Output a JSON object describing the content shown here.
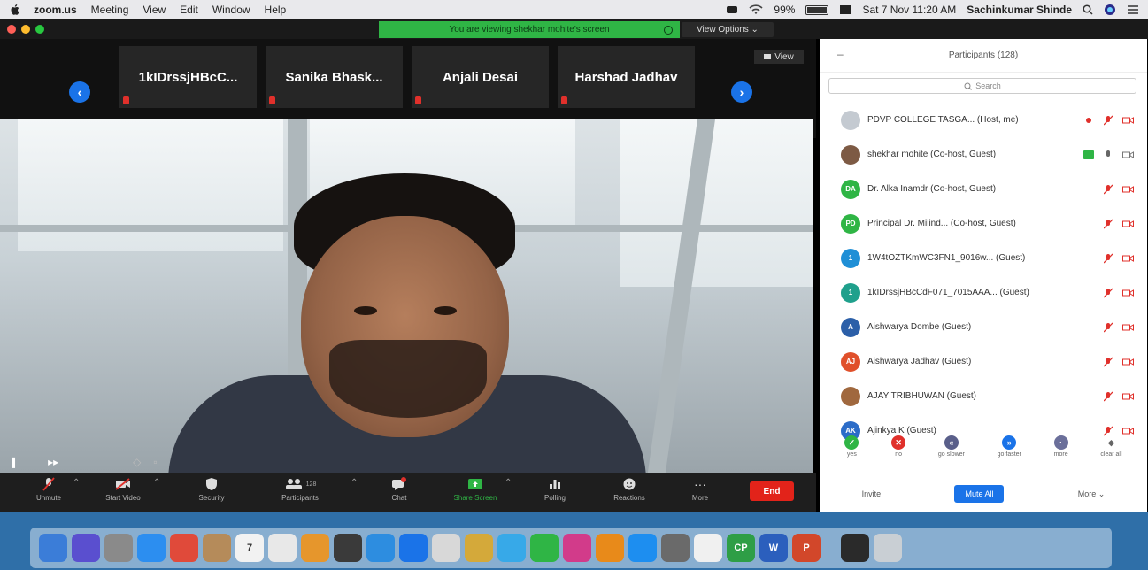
{
  "menubar": {
    "app": "zoom.us",
    "items": [
      "Meeting",
      "View",
      "Edit",
      "Window",
      "Help"
    ],
    "battery": "99%",
    "datetime": "Sat 7 Nov 11:20 AM",
    "user": "Sachinkumar Shinde"
  },
  "banner": {
    "text": "You are viewing shekhar mohite's screen",
    "view_options": "View Options ⌄"
  },
  "strip": {
    "thumbnails": [
      "1kIDrssjHBcC...",
      "Sanika Bhask...",
      "Anjali Desai",
      "Harshad Jadhav"
    ],
    "view_label": "View"
  },
  "toolbar": {
    "unmute": "Unmute",
    "start_video": "Start Video",
    "security": "Security",
    "participants": "Participants",
    "participants_count": "128",
    "chat": "Chat",
    "share_screen": "Share Screen",
    "polling": "Polling",
    "reactions": "Reactions",
    "more": "More",
    "end": "End"
  },
  "panel": {
    "title": "Participants (128)",
    "search_placeholder": "Search",
    "participants": [
      {
        "initials": "",
        "name": "PDVP COLLEGE TASGA... (Host, me)",
        "color": "#9aa3ad"
      },
      {
        "initials": "",
        "name": "shekhar mohite (Co-host, Guest)",
        "color": "#7d5a44"
      },
      {
        "initials": "DA",
        "name": "Dr. Alka Inamdr (Co-host, Guest)",
        "color": "#2fb545"
      },
      {
        "initials": "PD",
        "name": "Principal Dr. Milind... (Co-host, Guest)",
        "color": "#2fb545"
      },
      {
        "initials": "1",
        "name": "1W4tOZTKmWC3FN1_9016w... (Guest)",
        "color": "#1f8fd6"
      },
      {
        "initials": "1",
        "name": "1kIDrssjHBcCdF071_7015AAA... (Guest)",
        "color": "#1fa08c"
      },
      {
        "initials": "A",
        "name": "Aishwarya Dombe (Guest)",
        "color": "#2b5fa8"
      },
      {
        "initials": "AJ",
        "name": "Aishwarya Jadhav (Guest)",
        "color": "#e0502b"
      },
      {
        "initials": "",
        "name": "AJAY TRIBHUWAN (Guest)",
        "color": "#a0683e"
      },
      {
        "initials": "AK",
        "name": "Ajinkya K (Guest)",
        "color": "#2b6cc8"
      }
    ],
    "reactions": [
      "yes",
      "no",
      "go slower",
      "go faster",
      "more",
      "clear all"
    ],
    "invite": "Invite",
    "mute_all": "Mute All",
    "more": "More ⌄"
  },
  "dock": {
    "apps": [
      {
        "label": "",
        "color": "#3b7dd8"
      },
      {
        "label": "",
        "color": "#5a4fcf"
      },
      {
        "label": "",
        "color": "#8a8a8a"
      },
      {
        "label": "",
        "color": "#2c8ef0"
      },
      {
        "label": "",
        "color": "#e04a3a"
      },
      {
        "label": "",
        "color": "#b58b5a"
      },
      {
        "label": "7",
        "color": "#f2f2f2"
      },
      {
        "label": "",
        "color": "#e8e8e8"
      },
      {
        "label": "",
        "color": "#e6962c"
      },
      {
        "label": "",
        "color": "#3a3a3a"
      },
      {
        "label": "",
        "color": "#2d8de0"
      },
      {
        "label": "",
        "color": "#1a73e8"
      },
      {
        "label": "",
        "color": "#d8d8d8"
      },
      {
        "label": "",
        "color": "#d4a93a"
      },
      {
        "label": "",
        "color": "#37a9e8"
      },
      {
        "label": "",
        "color": "#2fb545"
      },
      {
        "label": "",
        "color": "#d23b8a"
      },
      {
        "label": "",
        "color": "#e88a1a"
      },
      {
        "label": "",
        "color": "#1d8ef0"
      },
      {
        "label": "",
        "color": "#6a6a6a"
      },
      {
        "label": "",
        "color": "#f0f0f0"
      },
      {
        "label": "CP",
        "color": "#2e9e46"
      },
      {
        "label": "W",
        "color": "#2b5fbd"
      },
      {
        "label": "P",
        "color": "#d2472a"
      },
      {
        "label": "",
        "color": "#2a2a2a"
      },
      {
        "label": "",
        "color": "#c9cfd4"
      }
    ]
  }
}
